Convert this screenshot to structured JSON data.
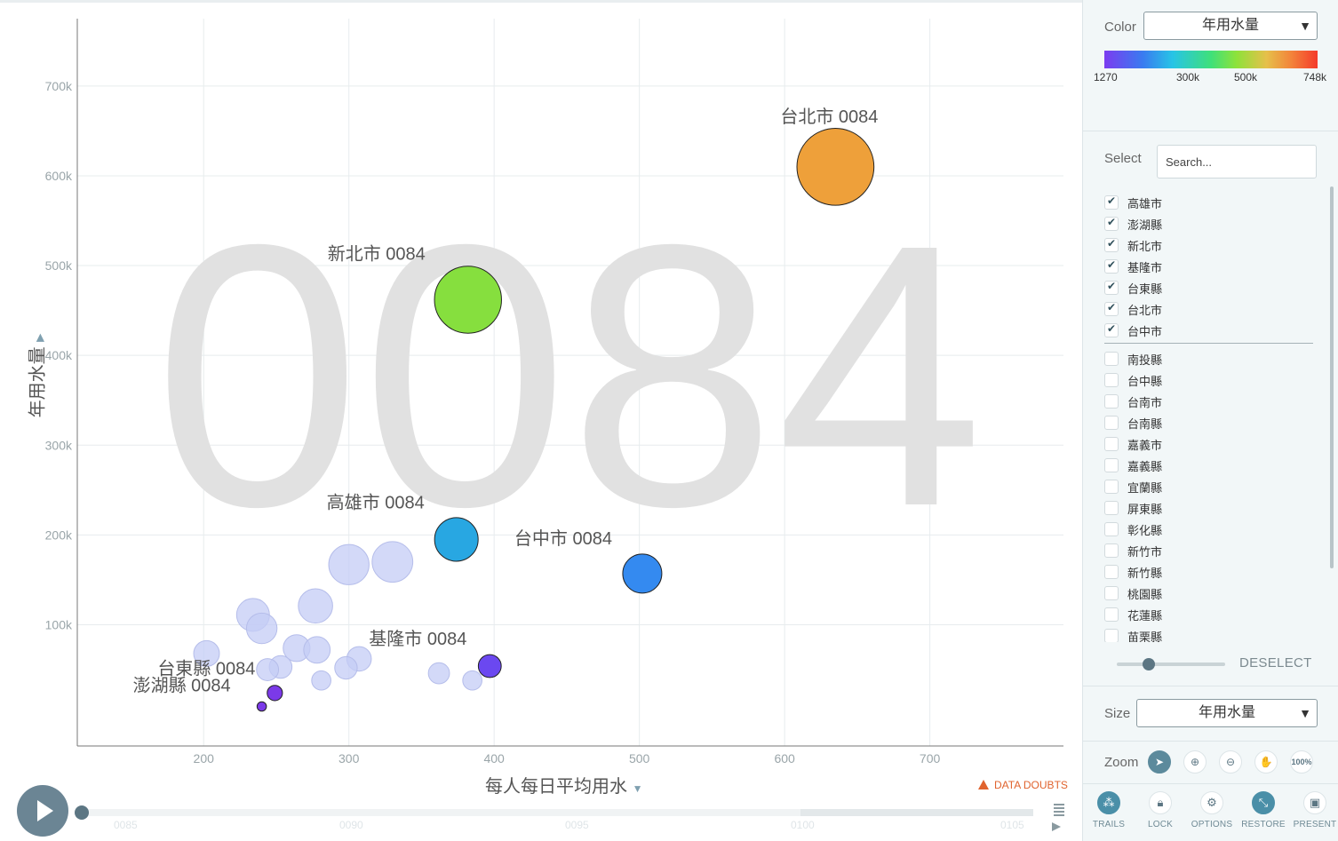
{
  "watermark": "0084",
  "axis": {
    "x_title": "每人每日平均用水",
    "y_title": "年用水量",
    "x_ticks": [
      "200",
      "300",
      "400",
      "500",
      "600",
      "700"
    ],
    "y_ticks": [
      "100k",
      "200k",
      "300k",
      "400k",
      "500k",
      "600k",
      "700k"
    ]
  },
  "chart_data": {
    "type": "scatter",
    "xlabel": "每人每日平均用水",
    "ylabel": "年用水量",
    "size_by": "年用水量",
    "color_by": "年用水量",
    "year": "0084",
    "xlim": [
      113,
      792
    ],
    "ylim": [
      -35000,
      775000
    ],
    "grid": true,
    "highlighted": [
      {
        "name": "台北市",
        "label": "台北市 0084",
        "x": 635,
        "y": 610000,
        "color": "#eea03a"
      },
      {
        "name": "新北市",
        "label": "新北市 0084",
        "x": 382,
        "y": 462000,
        "color": "#86df3e"
      },
      {
        "name": "高雄市",
        "label": "高雄市 0084",
        "x": 374,
        "y": 195000,
        "color": "#28a7e2"
      },
      {
        "name": "台中市",
        "label": "台中市 0084",
        "x": 502,
        "y": 157000,
        "color": "#348af0"
      },
      {
        "name": "基隆市",
        "label": "基隆市 0084",
        "x": 397,
        "y": 54000,
        "color": "#6b48f0"
      },
      {
        "name": "台東縣",
        "label": "台東縣 0084",
        "x": 249,
        "y": 24000,
        "color": "#7b3ae8"
      },
      {
        "name": "澎湖縣",
        "label": "澎湖縣 0084",
        "x": 240,
        "y": 9000,
        "color": "#7b3ae8"
      }
    ],
    "others": [
      {
        "x": 300,
        "y": 167000,
        "value": 167000
      },
      {
        "x": 330,
        "y": 170000,
        "value": 170000
      },
      {
        "x": 277,
        "y": 121000,
        "value": 121000
      },
      {
        "x": 234,
        "y": 111000,
        "value": 111000
      },
      {
        "x": 240,
        "y": 96000,
        "value": 96000
      },
      {
        "x": 264,
        "y": 74000,
        "value": 74000
      },
      {
        "x": 278,
        "y": 72000,
        "value": 72000
      },
      {
        "x": 202,
        "y": 68000,
        "value": 68000
      },
      {
        "x": 307,
        "y": 62000,
        "value": 62000
      },
      {
        "x": 253,
        "y": 53000,
        "value": 53000
      },
      {
        "x": 298,
        "y": 52000,
        "value": 52000
      },
      {
        "x": 244,
        "y": 50000,
        "value": 50000
      },
      {
        "x": 362,
        "y": 46000,
        "value": 46000
      },
      {
        "x": 281,
        "y": 38000,
        "value": 38000
      },
      {
        "x": 385,
        "y": 38000,
        "value": 38000
      }
    ]
  },
  "color": {
    "label": "Color",
    "selected": "年用水量",
    "scale_labels": [
      "1270",
      "300k",
      "500k",
      "748k"
    ]
  },
  "select": {
    "label": "Select",
    "search_placeholder": "Search...",
    "selected_items": [
      "高雄市",
      "澎湖縣",
      "新北市",
      "基隆市",
      "台東縣",
      "台北市",
      "台中市"
    ],
    "unselected_items": [
      "南投縣",
      "台中縣",
      "台南市",
      "台南縣",
      "嘉義市",
      "嘉義縣",
      "宜蘭縣",
      "屏東縣",
      "彰化縣",
      "新竹市",
      "新竹縣",
      "桃園縣",
      "花蓮縣",
      "苗栗縣"
    ],
    "deselect_label": "DESELECT"
  },
  "size": {
    "label": "Size",
    "selected": "年用水量"
  },
  "zoom": {
    "label": "Zoom",
    "reset_label": "100%"
  },
  "toolbar": [
    "TRAILS",
    "LOCK",
    "OPTIONS",
    "RESTORE",
    "PRESENT"
  ],
  "timeline": {
    "ticks": [
      "0085",
      "0090",
      "0095",
      "0100",
      "0105"
    ]
  },
  "data_doubts": "DATA DOUBTS"
}
